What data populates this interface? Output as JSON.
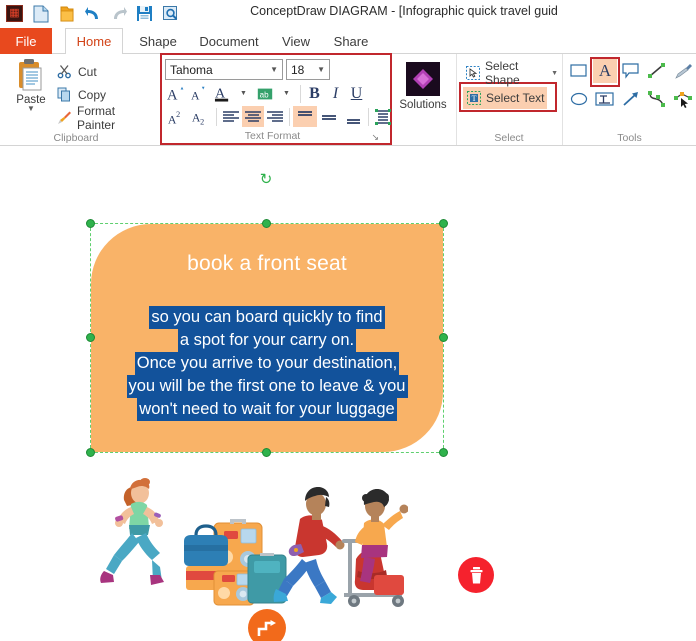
{
  "window": {
    "title": "ConceptDraw DIAGRAM - [Infographic quick travel guid"
  },
  "quick_access": {
    "items": [
      {
        "name": "app-menu-icon",
        "label": "ConceptDraw"
      },
      {
        "name": "new-document-icon",
        "label": "New"
      },
      {
        "name": "open-folder-icon",
        "label": "Open"
      },
      {
        "name": "undo-icon",
        "label": "Undo"
      },
      {
        "name": "redo-icon",
        "label": "Redo"
      },
      {
        "name": "save-icon",
        "label": "Save"
      },
      {
        "name": "preview-search-icon",
        "label": "Preview"
      }
    ]
  },
  "tabs": [
    {
      "label": "File",
      "active": false,
      "kind": "file"
    },
    {
      "label": "Home",
      "active": true,
      "kind": "normal"
    },
    {
      "label": "Shape",
      "active": false,
      "kind": "normal"
    },
    {
      "label": "Document",
      "active": false,
      "kind": "normal"
    },
    {
      "label": "View",
      "active": false,
      "kind": "normal"
    },
    {
      "label": "Share",
      "active": false,
      "kind": "normal"
    }
  ],
  "ribbon": {
    "clipboard": {
      "group_label": "Clipboard",
      "paste_label": "Paste",
      "cut_label": "Cut",
      "copy_label": "Copy",
      "format_painter_label": "Format Painter"
    },
    "text_format": {
      "group_label": "Text Format",
      "font_name": "Tahoma",
      "font_size": "18",
      "buttons": {
        "grow_font": "A",
        "shrink_font": "A",
        "font_color": "A",
        "highlight_color": "ab",
        "bold": "B",
        "italic": "I",
        "underline": "U",
        "superscript": "A2",
        "subscript": "A2",
        "align_left": "align-left",
        "align_center": "align-center",
        "align_right": "align-right",
        "valign_top": "valign-top",
        "valign_middle": "valign-middle",
        "valign_bottom": "valign-bottom",
        "text_block": "text-block"
      },
      "active_buttons": [
        "align_center",
        "valign_top"
      ],
      "dialog_launcher": "↘"
    },
    "solutions": {
      "label": "Solutions"
    },
    "select": {
      "group_label": "Select",
      "select_shape_label": "Select Shape",
      "select_text_label": "Select Text",
      "active": "Select Text"
    },
    "tools": {
      "group_label": "Tools",
      "row1": [
        "rectangle-tool",
        "text-tool",
        "callout-tool",
        "line-tool",
        "pen-tool"
      ],
      "row2": [
        "ellipse-tool",
        "textbox-tool",
        "arrow-tool",
        "curve-tool",
        "edit-points-tool"
      ],
      "active": "text-tool"
    }
  },
  "canvas": {
    "shape": {
      "fill_color": "#f9b368",
      "title": "book a front seat",
      "selected_text_lines": [
        "so you can board quickly to find",
        "a spot for your carry on.",
        "Once you arrive to your destination,",
        "you will be the first one to leave & you",
        "won't need to wait for your luggage"
      ],
      "selection_highlight_color": "#12529b",
      "handle_color": "#2fb24c"
    },
    "floating_buttons": [
      {
        "name": "delete-shape-button",
        "icon": "trash-icon",
        "color": "#f5222d"
      },
      {
        "name": "step-action-button",
        "icon": "step-arrow-icon",
        "color": "#f26a1b"
      }
    ],
    "illustration": {
      "name": "travel-people-luggage-illustration",
      "alt": "Running woman, suitcases, two travelers with luggage cart"
    }
  },
  "annotations": {
    "highlight_boxes": [
      "text-format-group",
      "select-text-button",
      "text-tool-button"
    ],
    "highlight_color": "#c1272d"
  }
}
